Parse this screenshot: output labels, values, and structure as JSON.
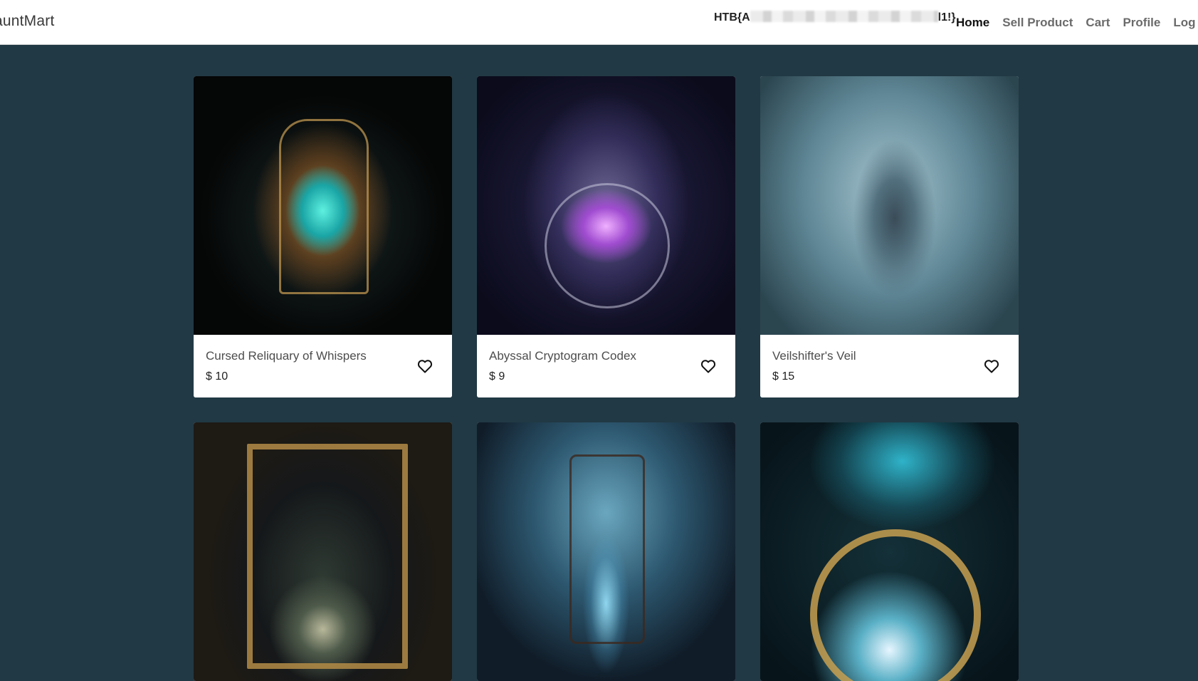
{
  "nav": {
    "brand": "auntMart",
    "flag_prefix": "HTB{A",
    "flag_suffix": "l1!}",
    "links": [
      {
        "label": "Home",
        "active": true
      },
      {
        "label": "Sell Product",
        "active": false
      },
      {
        "label": "Cart",
        "active": false
      },
      {
        "label": "Profile",
        "active": false
      },
      {
        "label": "Log",
        "active": false
      }
    ]
  },
  "products": [
    {
      "name": "Cursed Reliquary of Whispers",
      "price": "$ 10",
      "art": "lantern"
    },
    {
      "name": "Abyssal Cryptogram Codex",
      "price": "$ 9",
      "art": "urn"
    },
    {
      "name": "Veilshifter's Veil",
      "price": "$ 15",
      "art": "veil"
    },
    {
      "name": "",
      "price": "",
      "art": "mirror"
    },
    {
      "name": "",
      "price": "",
      "art": "hourglass"
    },
    {
      "name": "",
      "price": "",
      "art": "amulet"
    }
  ],
  "icons": {
    "favorite": "heart-outline-icon"
  },
  "colors": {
    "page_background": "#213944",
    "navbar_background": "#ffffff",
    "card_background": "#ffffff"
  }
}
